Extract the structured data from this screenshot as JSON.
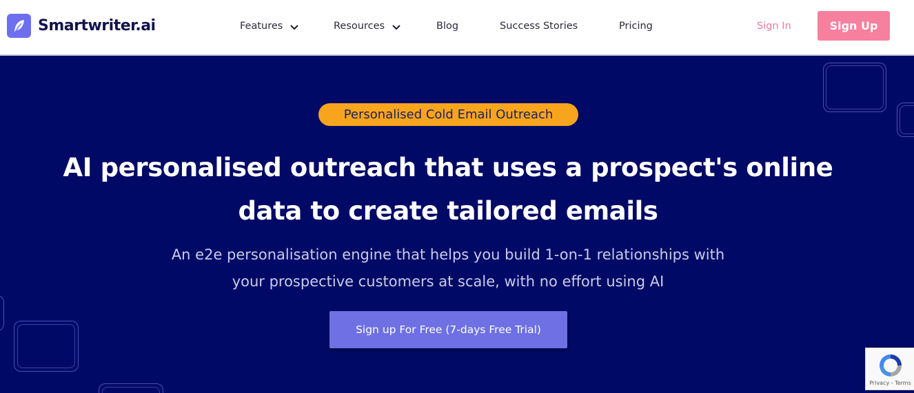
{
  "brand": {
    "name": "Smartwriter.ai",
    "icon": "feather-icon",
    "color": "#6d6ff0"
  },
  "nav": {
    "items": [
      {
        "label": "Features",
        "has_dropdown": true
      },
      {
        "label": "Resources",
        "has_dropdown": true
      },
      {
        "label": "Blog",
        "has_dropdown": false
      },
      {
        "label": "Success Stories",
        "has_dropdown": false
      },
      {
        "label": "Pricing",
        "has_dropdown": false
      }
    ],
    "sign_in": "Sign In",
    "sign_up": "Sign Up"
  },
  "hero": {
    "badge": "Personalised Cold Email Outreach",
    "headline_line1": "AI personalised outreach that uses a prospect's online",
    "headline_line2": "data to create tailored emails",
    "subline_line1": "An e2e personalisation engine that helps you build 1-on-1 relationships with",
    "subline_line2": "your prospective customers at scale, with no effort using AI",
    "cta": "Sign up For Free (7-days Free Trial)"
  },
  "recaptcha": {
    "text": "Privacy - Terms"
  },
  "colors": {
    "hero_bg": "#000a66",
    "badge_bg": "#f8a51e",
    "signup_bg": "#f6809e",
    "signin_text": "#f17aa0",
    "cta_bg": "#6e70e3"
  }
}
